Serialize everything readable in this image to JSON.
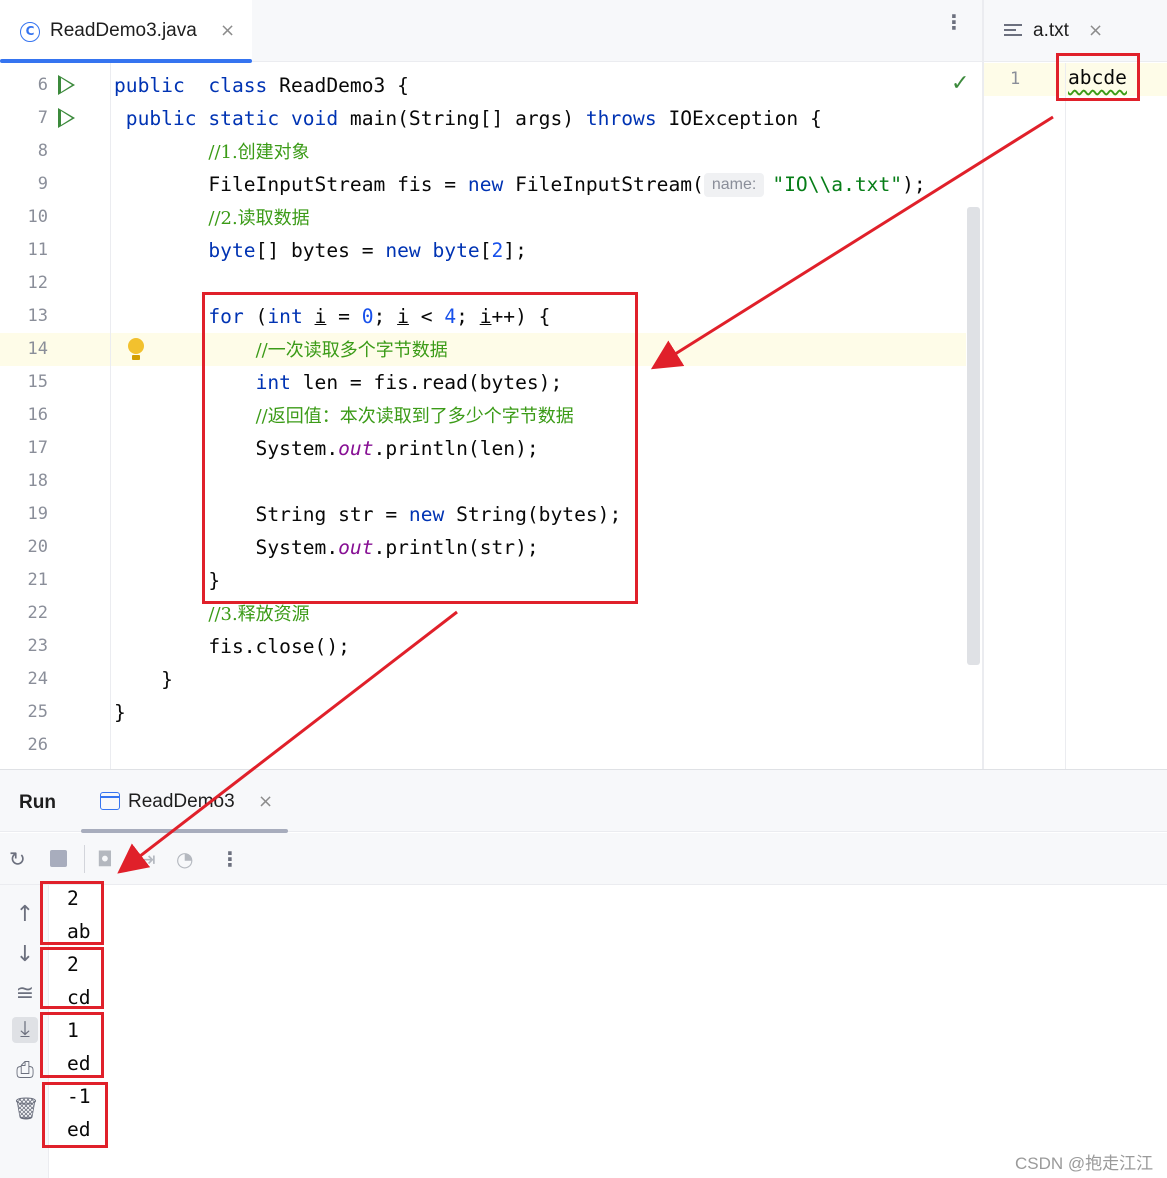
{
  "editor": {
    "tab": {
      "icon": "class-icon",
      "icon_glyph": "C",
      "title": "ReadDemo3.java",
      "close": "×"
    },
    "menu_glyph": "⋮",
    "lines": [
      {
        "n": "6",
        "run": true,
        "tokens": [
          [
            "kw",
            "public"
          ],
          [
            "",
            "  "
          ],
          [
            "kw",
            "class"
          ],
          [
            "",
            " ReadDemo3 {"
          ]
        ]
      },
      {
        "n": "7",
        "run": true,
        "tokens": [
          [
            "",
            " "
          ],
          [
            "kw",
            "public"
          ],
          [
            "",
            " "
          ],
          [
            "kw",
            "static"
          ],
          [
            "",
            " "
          ],
          [
            "kw",
            "void"
          ],
          [
            "",
            " main(String[] args) "
          ],
          [
            "kw",
            "throws"
          ],
          [
            "",
            " IOException {"
          ]
        ]
      },
      {
        "n": "8",
        "tokens": [
          [
            "",
            "        "
          ],
          [
            "cmt",
            "//1.创建对象"
          ]
        ]
      },
      {
        "n": "9",
        "tokens": [
          [
            "",
            "        FileInputStream fis = "
          ],
          [
            "kw",
            "new"
          ],
          [
            "",
            " FileInputStream("
          ],
          [
            "hint",
            "name:"
          ],
          [
            "str",
            "\"IO\\\\a.txt\""
          ],
          [
            "",
            ");"
          ]
        ]
      },
      {
        "n": "10",
        "tokens": [
          [
            "",
            "        "
          ],
          [
            "cmt",
            "//2.读取数据"
          ]
        ]
      },
      {
        "n": "11",
        "tokens": [
          [
            "",
            "        "
          ],
          [
            "kw",
            "byte"
          ],
          [
            "",
            "[] bytes = "
          ],
          [
            "kw",
            "new"
          ],
          [
            "",
            " "
          ],
          [
            "kw",
            "byte"
          ],
          [
            "",
            "["
          ],
          [
            "num",
            "2"
          ],
          [
            "",
            "];"
          ]
        ]
      },
      {
        "n": "12",
        "tokens": []
      },
      {
        "n": "13",
        "tokens": [
          [
            "",
            "        "
          ],
          [
            "kw",
            "for"
          ],
          [
            "",
            " ("
          ],
          [
            "kw",
            "int"
          ],
          [
            "",
            " "
          ],
          [
            "u",
            "i"
          ],
          [
            "",
            " = "
          ],
          [
            "num",
            "0"
          ],
          [
            "",
            "; "
          ],
          [
            "u",
            "i"
          ],
          [
            "",
            " < "
          ],
          [
            "num",
            "4"
          ],
          [
            "",
            "; "
          ],
          [
            "u",
            "i"
          ],
          [
            "",
            "++) {"
          ]
        ]
      },
      {
        "n": "14",
        "bulb": true,
        "current": true,
        "tokens": [
          [
            "",
            "            "
          ],
          [
            "cmt",
            "//一次读取多个字节数据"
          ]
        ]
      },
      {
        "n": "15",
        "tokens": [
          [
            "",
            "            "
          ],
          [
            "kw",
            "int"
          ],
          [
            "",
            " len = fis.read(bytes);"
          ]
        ]
      },
      {
        "n": "16",
        "tokens": [
          [
            "",
            "            "
          ],
          [
            "cmt",
            "//返回值：本次读取到了多少个字节数据"
          ]
        ]
      },
      {
        "n": "17",
        "tokens": [
          [
            "",
            "            System."
          ],
          [
            "fld",
            "out"
          ],
          [
            "",
            ".println(len);"
          ]
        ]
      },
      {
        "n": "18",
        "tokens": []
      },
      {
        "n": "19",
        "tokens": [
          [
            "",
            "            String str = "
          ],
          [
            "kw",
            "new"
          ],
          [
            "",
            " String(bytes);"
          ]
        ]
      },
      {
        "n": "20",
        "tokens": [
          [
            "",
            "            System."
          ],
          [
            "fld",
            "out"
          ],
          [
            "",
            ".println(str);"
          ]
        ]
      },
      {
        "n": "21",
        "tokens": [
          [
            "",
            "        }"
          ]
        ]
      },
      {
        "n": "22",
        "tokens": [
          [
            "",
            "        "
          ],
          [
            "cmt",
            "//3.释放资源"
          ]
        ]
      },
      {
        "n": "23",
        "tokens": [
          [
            "",
            "        fis.close();"
          ]
        ]
      },
      {
        "n": "24",
        "tokens": [
          [
            "",
            "    }"
          ]
        ]
      },
      {
        "n": "25",
        "tokens": [
          [
            "",
            "}"
          ]
        ]
      },
      {
        "n": "26",
        "tokens": []
      }
    ]
  },
  "txt_editor": {
    "tab": {
      "icon": "text-file-icon",
      "title": "a.txt",
      "close": "×"
    },
    "line_number": "1",
    "content": "abcde"
  },
  "run_panel": {
    "title": "Run",
    "tab": {
      "icon": "console-window-icon",
      "title": "ReadDemo3",
      "close": "×"
    },
    "toolbar_icons": [
      "rerun-icon",
      "stop-icon",
      "screenshot-icon",
      "export-icon",
      "profiler-icon",
      "more-icon"
    ],
    "sidebar_icons": [
      "scroll-up-icon",
      "scroll-down-icon",
      "soft-wrap-icon",
      "scroll-to-end-icon",
      "print-icon",
      "clear-icon"
    ],
    "output": [
      "2",
      "ab",
      "2",
      "cd",
      "1",
      "ed",
      "-1",
      "ed"
    ]
  },
  "colors": {
    "accent": "#3574f0",
    "annotation": "#e0202a",
    "keyword": "#0033b3",
    "comment": "#3b9b17",
    "string": "#067d17",
    "number": "#1750eb"
  },
  "watermark": "CSDN @抱走江江"
}
